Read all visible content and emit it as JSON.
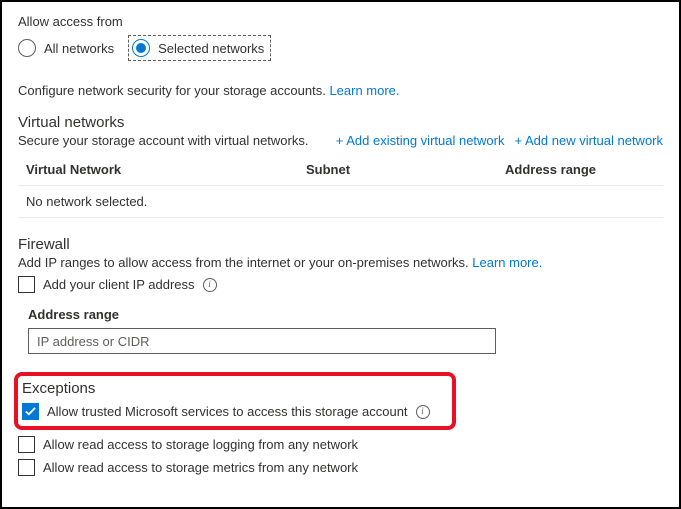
{
  "access": {
    "heading": "Allow access from",
    "all_label": "All networks",
    "selected_label": "Selected networks"
  },
  "configure_desc": "Configure network security for your storage accounts.",
  "learn_more": "Learn more.",
  "vnet": {
    "heading": "Virtual networks",
    "desc": "Secure your storage account with virtual networks.",
    "add_existing": "+ Add existing virtual network",
    "add_new": "+ Add new virtual network",
    "col_network": "Virtual Network",
    "col_subnet": "Subnet",
    "col_range": "Address range",
    "empty": "No network selected."
  },
  "firewall": {
    "heading": "Firewall",
    "desc": "Add IP ranges to allow access from the internet or your on-premises networks.",
    "add_client_ip": "Add your client IP address",
    "range_label": "Address range",
    "range_placeholder": "IP address or CIDR"
  },
  "exceptions": {
    "heading": "Exceptions",
    "trusted": "Allow trusted Microsoft services to access this storage account",
    "logging": "Allow read access to storage logging from any network",
    "metrics": "Allow read access to storage metrics from any network"
  }
}
